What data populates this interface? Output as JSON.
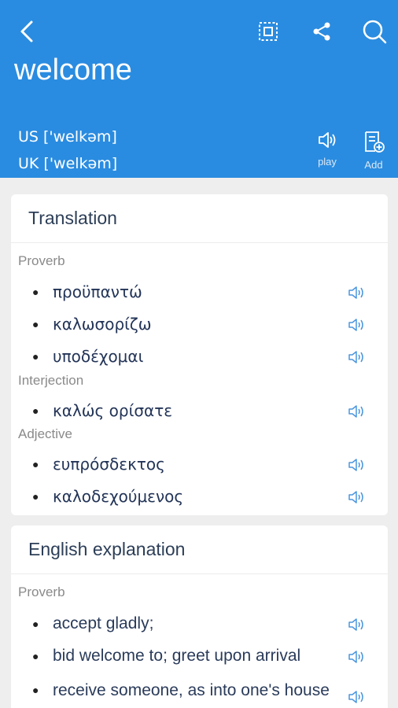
{
  "header": {
    "word": "welcome",
    "us_phonetic": "US ['welkəm]",
    "uk_phonetic": "UK ['welkəm]",
    "play_label": "play",
    "add_label": "Add",
    "accent_color": "#2a8ce0"
  },
  "translation": {
    "title": "Translation",
    "groups": [
      {
        "pos": "Proverb",
        "items": [
          "προϋπαντώ",
          "καλωσορίζω",
          "υποδέχομαι"
        ]
      },
      {
        "pos": "Interjection",
        "items": [
          "καλώς ορίσατε"
        ]
      },
      {
        "pos": "Adjective",
        "items": [
          "ευπρόσδεκτος",
          "καλοδεχούμενος"
        ]
      }
    ]
  },
  "explanation": {
    "title": "English explanation",
    "groups": [
      {
        "pos": "Proverb",
        "items": [
          "accept gladly;",
          "bid welcome to; greet upon arrival",
          "receive someone, as into one's house"
        ]
      }
    ]
  },
  "icons": [
    "back-icon",
    "select-icon",
    "share-icon",
    "search-icon",
    "speaker-icon",
    "add-wordbook-icon"
  ]
}
